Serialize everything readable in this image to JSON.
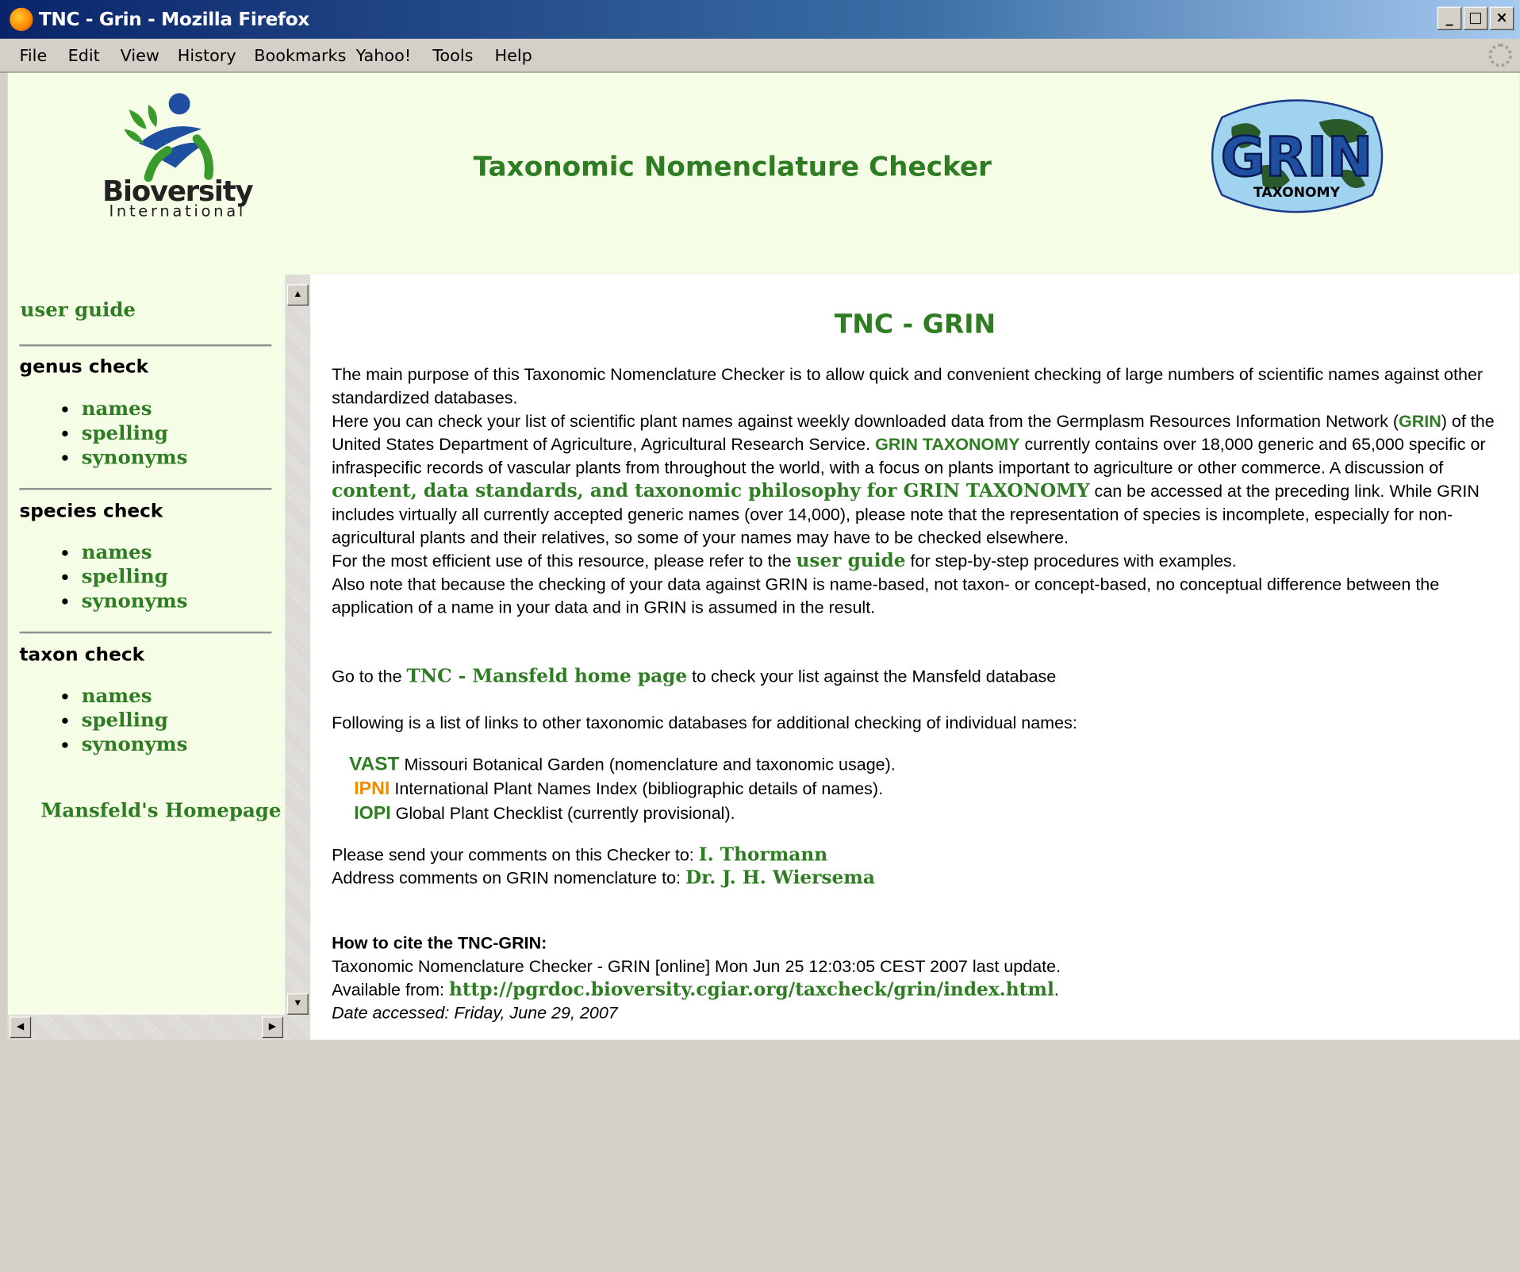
{
  "window": {
    "title": "TNC - Grin - Mozilla Firefox",
    "min": "_",
    "max": "□",
    "close": "×"
  },
  "menu": [
    "File",
    "Edit",
    "View",
    "History",
    "Bookmarks",
    "Yahoo!",
    "Tools",
    "Help"
  ],
  "header": {
    "title": "Taxonomic Nomenclature Checker",
    "bioversity_name": "Bioversity",
    "bioversity_sub": "International",
    "grin_logo_text": "GRIN",
    "grin_logo_sub": "TAXONOMY"
  },
  "sidebar": {
    "user_guide": "user guide",
    "sections": [
      {
        "heading": "genus check",
        "items": [
          "names",
          "spelling",
          "synonyms"
        ]
      },
      {
        "heading": "species check",
        "items": [
          "names",
          "spelling",
          "synonyms"
        ]
      },
      {
        "heading": "taxon check",
        "items": [
          "names",
          "spelling",
          "synonyms"
        ]
      }
    ],
    "mansfeld_link": "Mansfeld's Homepage"
  },
  "content": {
    "title": "TNC - GRIN",
    "p1": "The main purpose of this Taxonomic Nomenclature Checker is to allow quick and convenient checking of large numbers of scientific names against other standardized databases.",
    "p2a": "Here you can check your list of scientific plant names against weekly downloaded data from the Germplasm Resources Information Network (",
    "p2_grin": "GRIN",
    "p2b": ") of the United States Department of Agriculture, Agricultural Research Service. ",
    "p2_grin_tax": "GRIN TAXONOMY",
    "p2c": " currently contains over 18,000 generic and 65,000 specific or infraspecific records of vascular plants from throughout the world, with a focus on plants important to agriculture or other commerce. A discussion of ",
    "p2_content_link": "content, data standards, and taxonomic philosophy for GRIN TAXONOMY",
    "p2d": " can be accessed at the preceding link. While GRIN includes virtually all currently accepted generic names (over 14,000), please note that the representation of species is incomplete, especially for non-agricultural plants and their relatives, so some of your names may have to be checked elsewhere.",
    "p3a": "For the most efficient use of this resource, please refer to the ",
    "p3_link": "user guide",
    "p3b": " for step-by-step procedures with examples.",
    "p4": "Also note that because the checking of your data against GRIN is name-based, not taxon- or concept-based, no conceptual difference between the application of a name in your data and in GRIN is assumed in the result.",
    "p5a": "Go to the ",
    "p5_link": "TNC - Mansfeld home page",
    "p5b": " to check your list against the Mansfeld database",
    "p6": "Following is a list of links to other taxonomic databases for additional checking of individual names:",
    "databases": [
      {
        "name": "VAST",
        "desc": " Missouri Botanical Garden (nomenclature and taxonomic usage).",
        "color": "#2e7d22"
      },
      {
        "name": "IPNI",
        "desc": " International Plant Names Index (bibliographic details of names).",
        "color": "#f08c00"
      },
      {
        "name": "IOPI",
        "desc": " Global Plant Checklist (currently provisional).",
        "color": "#2e7d22"
      }
    ],
    "comments_a": "Please send your comments on this Checker to: ",
    "comments_link": "I. Thormann",
    "address_a": "Address comments on GRIN nomenclature to: ",
    "address_link": "Dr. J. H. Wiersema",
    "cite_heading": "How to cite the TNC-GRIN:",
    "cite_line": "Taxonomic Nomenclature Checker - GRIN [online] Mon Jun 25 12:03:05 CEST 2007 last update.",
    "available_a": "Available from: ",
    "available_link": "http://pgrdoc.bioversity.cgiar.org/taxcheck/grin/index.html",
    "available_b": ".",
    "date_accessed": "Date accessed: Friday, June 29, 2007"
  },
  "colors": {
    "accent_green": "#2e7d22",
    "ipni_orange": "#f08c00",
    "panel_bg": "#f5fde6"
  }
}
